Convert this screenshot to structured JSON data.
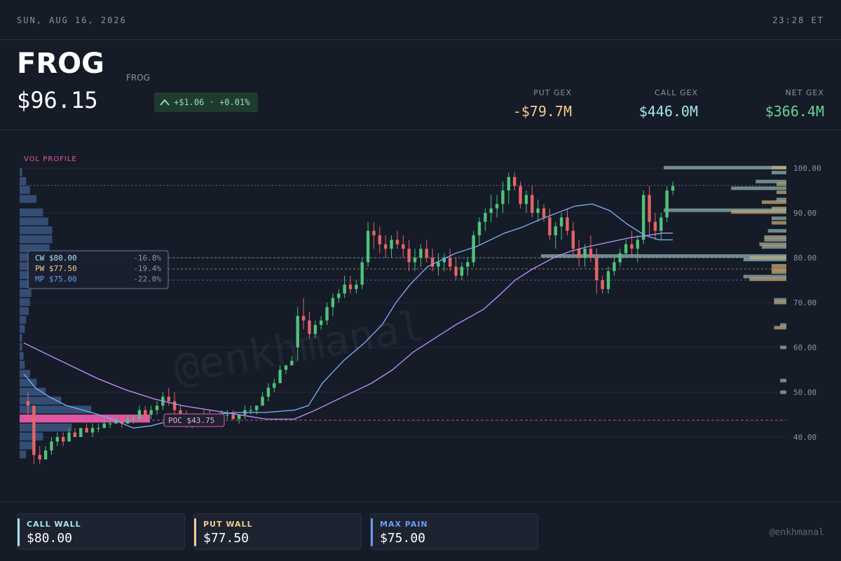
{
  "header": {
    "date": "SUN, AUG 16, 2026",
    "time": "23:28 ET",
    "ticker": "FROG",
    "subname": "FROG",
    "price": "$96.15",
    "change": "+$1.06 · +0.01%",
    "put_gex": {
      "label": "PUT GEX",
      "value": "-$79.7M"
    },
    "call_gex": {
      "label": "CALL GEX",
      "value": "$446.0M"
    },
    "net_gex": {
      "label": "NET GEX",
      "value": "$366.4M"
    }
  },
  "colors": {
    "background": "#151b27",
    "up": "#4fc27a",
    "down": "#e56366",
    "call": "#a8e6e8",
    "put": "#f1cd8f",
    "net": "#68d391",
    "maxpain": "#6b9cf5",
    "poc": "#e85aa8",
    "ma_fast": "#7aa9f0",
    "ma_slow": "#b68cf2"
  },
  "footer": {
    "cards": [
      {
        "label": "CALL WALL",
        "value": "$80.00",
        "color": "#a8e6e8"
      },
      {
        "label": "PUT WALL",
        "value": "$77.50",
        "color": "#f1cd8f"
      },
      {
        "label": "MAX PAIN",
        "value": "$75.00",
        "color": "#6b9cf5"
      }
    ],
    "handle": "@enkhmanal"
  },
  "chart_data": {
    "type": "candlestick",
    "ylim": [
      36,
      102
    ],
    "yticks": [
      "100.00",
      "90.00",
      "80.00",
      "70.00",
      "60.00",
      "50.00",
      "40.00"
    ],
    "ytick_values": [
      100,
      90,
      80,
      70,
      60,
      50,
      40
    ],
    "last_price": 96.15,
    "volume_profile_label": "VOL PROFILE",
    "watermark": "@enkhmanal",
    "poc": {
      "label": "POC $43.75",
      "price": 43.75
    },
    "levels": [
      {
        "key": "cw",
        "label": "CW $80.00",
        "pct": "-16.8%",
        "price": 80.0
      },
      {
        "key": "pw",
        "label": "PW $77.50",
        "pct": "-19.4%",
        "price": 77.5
      },
      {
        "key": "mp",
        "label": "MP $75.00",
        "pct": "-22.0%",
        "price": 75.0
      }
    ],
    "candles": [
      [
        48,
        50,
        44,
        47
      ],
      [
        47,
        47,
        34,
        36
      ],
      [
        36,
        38,
        34,
        35
      ],
      [
        35,
        38,
        35,
        37
      ],
      [
        37,
        40,
        36,
        39
      ],
      [
        39,
        41,
        38,
        40
      ],
      [
        40,
        41,
        38,
        39
      ],
      [
        39,
        42,
        39,
        41
      ],
      [
        41,
        42,
        40,
        40
      ],
      [
        40,
        42,
        40,
        42
      ],
      [
        42,
        43,
        41,
        41
      ],
      [
        41,
        43,
        40,
        42
      ],
      [
        42,
        43,
        41,
        42
      ],
      [
        42,
        44,
        42,
        43
      ],
      [
        43,
        44,
        42,
        43
      ],
      [
        43,
        44,
        43,
        44
      ],
      [
        44,
        44,
        42,
        43
      ],
      [
        43,
        45,
        43,
        44
      ],
      [
        44,
        45,
        43,
        44
      ],
      [
        44,
        47,
        44,
        46
      ],
      [
        46,
        47,
        44,
        45
      ],
      [
        45,
        47,
        44,
        46
      ],
      [
        46,
        48,
        45,
        47
      ],
      [
        47,
        50,
        46,
        49
      ],
      [
        49,
        51,
        47,
        48
      ],
      [
        48,
        50,
        45,
        46
      ],
      [
        46,
        47,
        44,
        45
      ],
      [
        45,
        46,
        42,
        43
      ],
      [
        43,
        45,
        42,
        44
      ],
      [
        44,
        45,
        43,
        44
      ],
      [
        44,
        46,
        44,
        45
      ],
      [
        45,
        46,
        43,
        44
      ],
      [
        44,
        45,
        43,
        44
      ],
      [
        44,
        46,
        44,
        45
      ],
      [
        45,
        46,
        44,
        45
      ],
      [
        45,
        46,
        44,
        44
      ],
      [
        44,
        45,
        43,
        45
      ],
      [
        45,
        47,
        44,
        46
      ],
      [
        46,
        47,
        45,
        46
      ],
      [
        46,
        47,
        45,
        47
      ],
      [
        47,
        50,
        47,
        49
      ],
      [
        49,
        52,
        48,
        51
      ],
      [
        51,
        53,
        50,
        52
      ],
      [
        52,
        56,
        52,
        55
      ],
      [
        55,
        56,
        54,
        56
      ],
      [
        56,
        58,
        56,
        57
      ],
      [
        60,
        69,
        57,
        67
      ],
      [
        67,
        71,
        64,
        66
      ],
      [
        66,
        68,
        62,
        63
      ],
      [
        63,
        66,
        62,
        65
      ],
      [
        65,
        67,
        64,
        66
      ],
      [
        66,
        70,
        65,
        69
      ],
      [
        69,
        72,
        67,
        71
      ],
      [
        71,
        73,
        70,
        72
      ],
      [
        72,
        76,
        71,
        74
      ],
      [
        74,
        76,
        72,
        73
      ],
      [
        73,
        75,
        72,
        74
      ],
      [
        74,
        80,
        73,
        79
      ],
      [
        79,
        88,
        78,
        86
      ],
      [
        86,
        88,
        82,
        85
      ],
      [
        85,
        87,
        81,
        83
      ],
      [
        83,
        85,
        80,
        82
      ],
      [
        82,
        85,
        80,
        84
      ],
      [
        84,
        86,
        82,
        83
      ],
      [
        83,
        85,
        80,
        82
      ],
      [
        82,
        84,
        77,
        79
      ],
      [
        79,
        82,
        77,
        80
      ],
      [
        80,
        83,
        78,
        82
      ],
      [
        82,
        84,
        79,
        80
      ],
      [
        80,
        82,
        77,
        78
      ],
      [
        78,
        81,
        76,
        79
      ],
      [
        79,
        81,
        77,
        80
      ],
      [
        80,
        82,
        77,
        78
      ],
      [
        78,
        80,
        75,
        76
      ],
      [
        76,
        79,
        75,
        78
      ],
      [
        78,
        80,
        76,
        79
      ],
      [
        79,
        86,
        78,
        85
      ],
      [
        85,
        89,
        83,
        88
      ],
      [
        88,
        91,
        86,
        90
      ],
      [
        90,
        94,
        88,
        91
      ],
      [
        91,
        94,
        89,
        92
      ],
      [
        92,
        97,
        90,
        95
      ],
      [
        95,
        99,
        92,
        98
      ],
      [
        98,
        99,
        95,
        96
      ],
      [
        96,
        97,
        91,
        92
      ],
      [
        92,
        95,
        90,
        94
      ],
      [
        94,
        96,
        89,
        90
      ],
      [
        90,
        93,
        88,
        91
      ],
      [
        91,
        92,
        88,
        89
      ],
      [
        89,
        91,
        84,
        85
      ],
      [
        85,
        88,
        82,
        87
      ],
      [
        87,
        90,
        84,
        89
      ],
      [
        89,
        91,
        85,
        86
      ],
      [
        86,
        88,
        80,
        82
      ],
      [
        82,
        84,
        78,
        80
      ],
      [
        80,
        83,
        78,
        82
      ],
      [
        82,
        85,
        79,
        80
      ],
      [
        80,
        82,
        72,
        75
      ],
      [
        75,
        76,
        72,
        73
      ],
      [
        73,
        78,
        72,
        77
      ],
      [
        77,
        80,
        76,
        79
      ],
      [
        79,
        82,
        78,
        81
      ],
      [
        81,
        84,
        80,
        83
      ],
      [
        83,
        86,
        80,
        82
      ],
      [
        82,
        85,
        79,
        84
      ],
      [
        84,
        95,
        83,
        94
      ],
      [
        94,
        96,
        85,
        88
      ],
      [
        88,
        90,
        84,
        86
      ],
      [
        86,
        90,
        84,
        89
      ],
      [
        89,
        96,
        88,
        95
      ],
      [
        95,
        97,
        94,
        96
      ]
    ],
    "ma_fast": [
      [
        34,
        54
      ],
      [
        40,
        53
      ],
      [
        50,
        51
      ],
      [
        70,
        49
      ],
      [
        95,
        47
      ],
      [
        130,
        45.5
      ],
      [
        160,
        44
      ],
      [
        190,
        42
      ],
      [
        215,
        42.5
      ],
      [
        240,
        43.5
      ],
      [
        270,
        44.5
      ],
      [
        300,
        45
      ],
      [
        340,
        45.5
      ],
      [
        380,
        45.5
      ],
      [
        420,
        46
      ],
      [
        440,
        47
      ],
      [
        460,
        52
      ],
      [
        490,
        57
      ],
      [
        520,
        61
      ],
      [
        545,
        65
      ],
      [
        565,
        70
      ],
      [
        585,
        74
      ],
      [
        610,
        78
      ],
      [
        630,
        79.5
      ],
      [
        650,
        81
      ],
      [
        680,
        82.5
      ],
      [
        700,
        84
      ],
      [
        720,
        85.5
      ],
      [
        745,
        86.8
      ],
      [
        770,
        88.5
      ],
      [
        795,
        90
      ],
      [
        820,
        91.5
      ],
      [
        845,
        92
      ],
      [
        870,
        90.5
      ],
      [
        895,
        87.5
      ],
      [
        920,
        85
      ],
      [
        940,
        84
      ],
      [
        960,
        84
      ]
    ],
    "ma_slow": [
      [
        34,
        61
      ],
      [
        60,
        59
      ],
      [
        100,
        56
      ],
      [
        140,
        53
      ],
      [
        180,
        50.5
      ],
      [
        220,
        48.5
      ],
      [
        260,
        47
      ],
      [
        300,
        46
      ],
      [
        340,
        45
      ],
      [
        380,
        44
      ],
      [
        420,
        44
      ],
      [
        450,
        46
      ],
      [
        490,
        49
      ],
      [
        530,
        52
      ],
      [
        560,
        55
      ],
      [
        590,
        59
      ],
      [
        620,
        62
      ],
      [
        650,
        65
      ],
      [
        690,
        68.5
      ],
      [
        715,
        72
      ],
      [
        735,
        75
      ],
      [
        760,
        77.5
      ],
      [
        790,
        80
      ],
      [
        815,
        81.5
      ],
      [
        840,
        82.5
      ],
      [
        870,
        83.5
      ],
      [
        900,
        84.5
      ],
      [
        925,
        85
      ],
      [
        945,
        85.5
      ],
      [
        960,
        85.5
      ]
    ],
    "vol_profile_left": [
      [
        99,
        2
      ],
      [
        97,
        5
      ],
      [
        95,
        8
      ],
      [
        93,
        13
      ],
      [
        90,
        18
      ],
      [
        88,
        22
      ],
      [
        86,
        25
      ],
      [
        84,
        25
      ],
      [
        82,
        23
      ],
      [
        80,
        20
      ],
      [
        78,
        18
      ],
      [
        76,
        12
      ],
      [
        74,
        10
      ],
      [
        72,
        9
      ],
      [
        70,
        8
      ],
      [
        68,
        7
      ],
      [
        66,
        5
      ],
      [
        64,
        4
      ],
      [
        62,
        2
      ],
      [
        60,
        2
      ],
      [
        58,
        3
      ],
      [
        56,
        4
      ],
      [
        54,
        8
      ],
      [
        52,
        13
      ],
      [
        50,
        20
      ],
      [
        48,
        32
      ],
      [
        46,
        55
      ],
      [
        44,
        100
      ],
      [
        42,
        40
      ],
      [
        40,
        18
      ],
      [
        38,
        10
      ],
      [
        36,
        5
      ]
    ],
    "gex_profile": [
      [
        100.1,
        "c",
        1.0
      ],
      [
        100.1,
        "p",
        0.12
      ],
      [
        99,
        "c",
        0.12
      ],
      [
        97,
        "c",
        0.25
      ],
      [
        96.4,
        "p",
        0.08
      ],
      [
        95.5,
        "c",
        0.45
      ],
      [
        94.6,
        "p",
        0.08
      ],
      [
        93,
        "c",
        0.08
      ],
      [
        92.4,
        "p",
        0.2
      ],
      [
        91,
        "p",
        0.12
      ],
      [
        90.6,
        "c",
        1.0
      ],
      [
        90.2,
        "p",
        0.45
      ],
      [
        88.8,
        "c",
        0.12
      ],
      [
        87.8,
        "p",
        0.12
      ],
      [
        86,
        "c",
        0.15
      ],
      [
        84.6,
        "p",
        0.18
      ],
      [
        84,
        "c",
        0.18
      ],
      [
        83,
        "p",
        0.22
      ],
      [
        82.4,
        "c",
        0.2
      ],
      [
        80.4,
        "c",
        2.0
      ],
      [
        80,
        "p",
        0.3
      ],
      [
        79.6,
        "c",
        0.35
      ],
      [
        78.2,
        "p",
        0.12
      ],
      [
        77.4,
        "p",
        0.12
      ],
      [
        76.8,
        "p",
        0.12
      ],
      [
        75.8,
        "c",
        0.35
      ],
      [
        75.2,
        "p",
        0.3
      ],
      [
        70.6,
        "c",
        0.1
      ],
      [
        70,
        "p",
        0.1
      ],
      [
        65,
        "c",
        0.05
      ],
      [
        64.4,
        "p",
        0.1
      ],
      [
        60,
        "c",
        0.05
      ],
      [
        52.6,
        "c",
        0.05
      ],
      [
        50,
        "c",
        0.05
      ]
    ]
  }
}
